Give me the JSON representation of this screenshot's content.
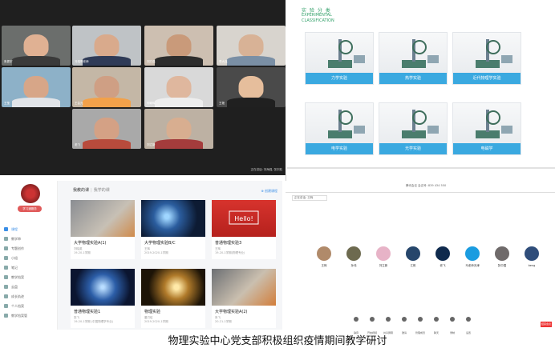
{
  "caption": "物理实验中心党支部积极组织疫情期间教学研讨",
  "video_conference": {
    "tiles": [
      {
        "label": "朱振宇",
        "bg": "#6b6e6c",
        "face": "#e0b193",
        "shirt": "#3a3a3a"
      },
      {
        "label": "冯瑞哥老师",
        "bg": "#bfc3c6",
        "face": "#d9aa8c",
        "shirt": "#2f3b57"
      },
      {
        "label": "刘方强",
        "bg": "#cdbfb1",
        "face": "#c99a7a",
        "shirt": "#2d2d2d"
      },
      {
        "label": "李大连",
        "bg": "#d8d4ce",
        "face": "#d8b296",
        "shirt": "#7a8fa5"
      },
      {
        "label": "王莹",
        "bg": "#8db1c8",
        "face": "#d7a688",
        "shirt": "#e1e4e8"
      },
      {
        "label": "王会元",
        "bg": "#c4b7a6",
        "face": "#cf9f84",
        "shirt": "#f2a14a"
      },
      {
        "label": "何朝晖",
        "bg": "#d9d9d9",
        "face": "#dfb79e",
        "shirt": "#eeeeee"
      },
      {
        "label": "王艳",
        "bg": "#4a4a4a",
        "face": "#e6be9c",
        "shirt": "#202020"
      },
      {
        "label": "老飞",
        "bg": "#a9a9a9",
        "face": "#d4a185",
        "shirt": "#b84b3c"
      },
      {
        "label": "刘立新",
        "bg": "#bdb1a3",
        "face": "#d8ae90",
        "shirt": "#a43c3c"
      }
    ],
    "corner_text": "正在讲话: 刘海强, 张宇航"
  },
  "experiment_page": {
    "title": "实 验 分 类",
    "subtitle_line1": "EXPERIMENTAL",
    "subtitle_line2": "CLASSIFICATION",
    "categories": [
      "力学实验",
      "热学实验",
      "近代物理学实验",
      "电学实验",
      "光学实验",
      "电磁学"
    ]
  },
  "course_portal": {
    "badge": "学习通服务",
    "menu": [
      "课程",
      "教学审",
      "专题创作",
      "小组",
      "笔记",
      "教学档案",
      "云盘",
      "成长轨迹",
      "个人档案",
      "教学档案管"
    ],
    "active_menu": 0,
    "tab_active": "我教的课",
    "tab_other": "我学的课",
    "add_label": "⊕ 创建课程",
    "courses": [
      {
        "name": "大学物理实验A(1)",
        "meta1": "刘晓英",
        "meta2": "19-20-1学期",
        "bg": "linear-gradient(135deg,#8a8d92,#c7c0b5 60%,#d08a4a)"
      },
      {
        "name": "大学物理实验B/C",
        "meta1": "王辉",
        "meta2": "2019-2020-1学期",
        "bg": "radial-gradient(circle at 40% 45%,#9fd6ff 5%,#2b5d9e 30%,#0d1b33 70%)"
      },
      {
        "name": "普通物理实验3",
        "meta1": "王辉",
        "meta2": "19-20-1学期(物理专业)",
        "bg": "linear-gradient(#d7332d,#b5211d)"
      },
      {
        "name": "普通物理实验1",
        "meta1": "张飞",
        "meta2": "19-20-1学期 (中国物理学专业)",
        "bg": "radial-gradient(circle at 50% 50%,#b9ddff 4%,#2c5ea8 35%,#0b1530 75%)"
      },
      {
        "name": "物理实验",
        "meta1": "董刃伍",
        "meta2": "2019-2020-1学期",
        "bg": "radial-gradient(circle at 55% 50%,#ffe9a8 6%,#b07a2a 30%,#1d1407 70%)"
      },
      {
        "name": "大学物理实验A(2)",
        "meta1": "朱飞",
        "meta2": "20-21-1学期",
        "bg": "linear-gradient(135deg,#6c6f73,#cabfaf 55%,#d27e3b)"
      }
    ]
  },
  "meeting_app": {
    "info_text": "腾讯会议  会议号: 839 434 550",
    "chip_text": "正在讲话: 王辉",
    "participants": [
      {
        "name": "王辉",
        "color": "#b08a6a"
      },
      {
        "name": "孙伟",
        "color": "#6d6a4f"
      },
      {
        "name": "刘立新",
        "color": "#e7b3c7"
      },
      {
        "name": "江帆",
        "color": "#26466b"
      },
      {
        "name": "老飞",
        "color": "#0f2a4d"
      },
      {
        "name": "马老师天津",
        "color": "#1a9ce0"
      },
      {
        "name": "张中国",
        "color": "#6f6a6a"
      },
      {
        "name": "beng",
        "color": "#2f4d7a"
      }
    ],
    "toolbar": [
      "静音",
      "开启视频",
      "共享屏幕",
      "邀请",
      "管理成员",
      "聊天",
      "录制",
      "设置"
    ],
    "end_label": "结束会议"
  }
}
